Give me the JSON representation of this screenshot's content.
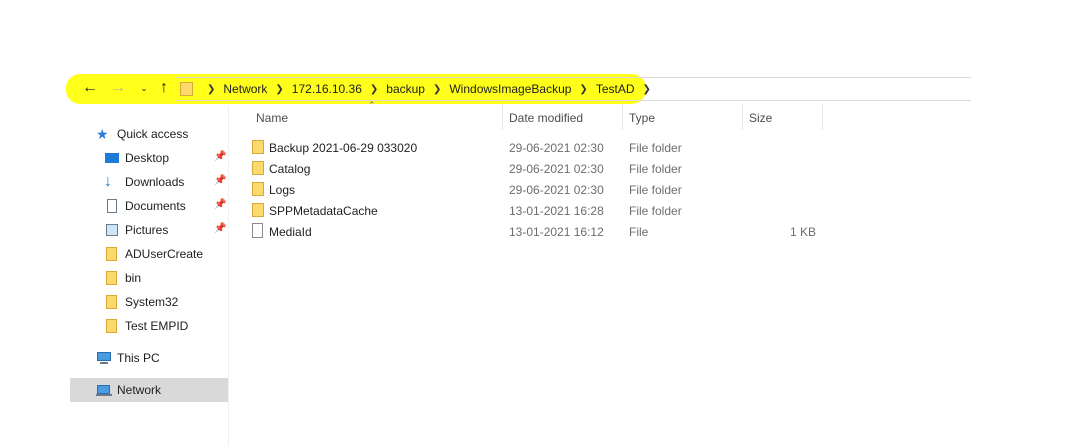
{
  "address_bar": {
    "crumbs": [
      "Network",
      "172.16.10.36",
      "backup",
      "WindowsImageBackup",
      "TestAD"
    ],
    "back_icon": "arrow-left-icon",
    "forward_icon": "arrow-right-icon",
    "recent_icon": "chevron-down-icon",
    "up_icon": "arrow-up-icon",
    "highlight_color": "#ffff1a"
  },
  "sidebar": {
    "quick_access": "Quick access",
    "items": [
      {
        "label": "Desktop",
        "icon": "desktop-icon",
        "pinned": true
      },
      {
        "label": "Downloads",
        "icon": "downloads-icon",
        "pinned": true
      },
      {
        "label": "Documents",
        "icon": "documents-icon",
        "pinned": true
      },
      {
        "label": "Pictures",
        "icon": "pictures-icon",
        "pinned": true
      },
      {
        "label": "ADUserCreate",
        "icon": "folder-icon",
        "pinned": false
      },
      {
        "label": "bin",
        "icon": "folder-icon",
        "pinned": false
      },
      {
        "label": "System32",
        "icon": "folder-icon",
        "pinned": false
      },
      {
        "label": "Test EMPID",
        "icon": "folder-icon",
        "pinned": false
      }
    ],
    "this_pc": "This PC",
    "network": "Network"
  },
  "file_list": {
    "columns": {
      "name": "Name",
      "date": "Date modified",
      "type": "Type",
      "size": "Size"
    },
    "rows": [
      {
        "name": "Backup 2021-06-29 033020",
        "date": "29-06-2021 02:30",
        "type": "File folder",
        "size": "",
        "kind": "folder"
      },
      {
        "name": "Catalog",
        "date": "29-06-2021 02:30",
        "type": "File folder",
        "size": "",
        "kind": "folder"
      },
      {
        "name": "Logs",
        "date": "29-06-2021 02:30",
        "type": "File folder",
        "size": "",
        "kind": "folder"
      },
      {
        "name": "SPPMetadataCache",
        "date": "13-01-2021 16:28",
        "type": "File folder",
        "size": "",
        "kind": "folder"
      },
      {
        "name": "MediaId",
        "date": "13-01-2021 16:12",
        "type": "File",
        "size": "1 KB",
        "kind": "file"
      }
    ]
  }
}
